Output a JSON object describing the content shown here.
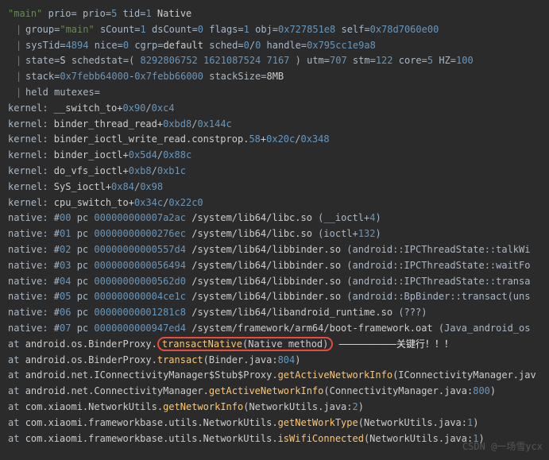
{
  "header": {
    "thread_name": "\"main\"",
    "prio_label": "prio=",
    "prio": "5",
    "tid_label": "tid=",
    "tid": "1",
    "type": "Native"
  },
  "group_line": {
    "group_label": "group=",
    "group": "\"main\"",
    "sCount_label": "sCount=",
    "sCount": "1",
    "dsCount_label": "dsCount=",
    "dsCount": "0",
    "flags_label": "flags=",
    "flags": "1",
    "obj_label": "obj=",
    "obj": "0x727851e8",
    "self_label": "self=",
    "self": "0x78d7060e00"
  },
  "systid_line": {
    "sysTid_label": "sysTid=",
    "sysTid": "4894",
    "nice_label": "nice=",
    "nice": "0",
    "cgrp_label": "cgrp=",
    "cgrp": "default",
    "sched_label": "sched=",
    "sched_a": "0",
    "slash": "/",
    "sched_b": "0",
    "handle_label": "handle=",
    "handle": "0x795cc1e9a8"
  },
  "state_line": {
    "state_label": "state=",
    "state": "S",
    "schedstat_label": "schedstat=( ",
    "ss1": "8292806752",
    "ss2": "1621087524",
    "ss3": "7167",
    "schedstat_close": " )",
    "utm_label": "utm=",
    "utm": "707",
    "stm_label": "stm=",
    "stm": "122",
    "core_label": "core=",
    "core": "5",
    "hz_label": "HZ=",
    "hz": "100"
  },
  "stack_line": {
    "stack_label": "stack=",
    "stack_a": "0x7febb64000",
    "dash": "-",
    "stack_b": "0x7febb66000",
    "stackSize_label": "stackSize=",
    "stackSize": "8MB"
  },
  "held_line": {
    "text": "held mutexes="
  },
  "kernel": [
    {
      "prefix": "kernel: ",
      "name": "__switch_to+",
      "a": "0x90",
      "sep": "/",
      "b": "0xc4"
    },
    {
      "prefix": "kernel: ",
      "name": "binder_thread_read+",
      "a": "0xbd8",
      "sep": "/",
      "b": "0x144c"
    },
    {
      "prefix": "kernel: ",
      "name": "binder_ioctl_write_read.constprop.",
      "mid": "58",
      "plus": "+",
      "a": "0x20c",
      "sep": "/",
      "b": "0x348"
    },
    {
      "prefix": "kernel: ",
      "name": "binder_ioctl+",
      "a": "0x5d4",
      "sep": "/",
      "b": "0x88c"
    },
    {
      "prefix": "kernel: ",
      "name": "do_vfs_ioctl+",
      "a": "0xb8",
      "sep": "/",
      "b": "0xb1c"
    },
    {
      "prefix": "kernel: ",
      "name": "SyS_ioctl+",
      "a": "0x84",
      "sep": "/",
      "b": "0x98"
    },
    {
      "prefix": "kernel: ",
      "name": "cpu_switch_to+",
      "a": "0x34c",
      "sep": "/",
      "b": "0x22c0"
    }
  ],
  "native": [
    {
      "prefix": "native: #",
      "num": "00",
      "pc_label": " pc ",
      "pc": "000000000007a2ac",
      "path": "/system/lib64/libc.so ",
      "sym": "(__ioctl+",
      "off": "4",
      "close": ")"
    },
    {
      "prefix": "native: #",
      "num": "01",
      "pc_label": " pc ",
      "pc": "00000000000276ec",
      "path": "/system/lib64/libc.so ",
      "sym": "(ioctl+",
      "off": "132",
      "close": ")"
    },
    {
      "prefix": "native: #",
      "num": "02",
      "pc_label": " pc ",
      "pc": "00000000000557d4",
      "path": "/system/lib64/libbinder.so ",
      "sym": "(android::IPCThreadState::talkWi"
    },
    {
      "prefix": "native: #",
      "num": "03",
      "pc_label": " pc ",
      "pc": "0000000000056494",
      "path": "/system/lib64/libbinder.so ",
      "sym": "(android::IPCThreadState::waitFo"
    },
    {
      "prefix": "native: #",
      "num": "04",
      "pc_label": " pc ",
      "pc": "00000000000562d0",
      "path": "/system/lib64/libbinder.so ",
      "sym": "(android::IPCThreadState::transa"
    },
    {
      "prefix": "native: #",
      "num": "05",
      "pc_label": " pc ",
      "pc": "000000000004ce1c",
      "path": "/system/lib64/libbinder.so ",
      "sym": "(android::BpBinder::transact(uns"
    },
    {
      "prefix": "native: #",
      "num": "06",
      "pc_label": " pc ",
      "pc": "00000000001281c8",
      "path": "/system/lib64/libandroid_runtime.so ",
      "sym": "(???)"
    },
    {
      "prefix": "native: #",
      "num": "07",
      "pc_label": " pc ",
      "pc": "0000000000947ed4",
      "path": "/system/framework/arm64/boot-framework.oat ",
      "sym": "(Java_android_os"
    }
  ],
  "java": [
    {
      "prefix": "at ",
      "cls": "android.os.BinderProxy.",
      "method": "transactNative",
      "args": "(Native method)",
      "highlight": true,
      "annot": " ——————————关键行！！！"
    },
    {
      "prefix": "at ",
      "cls": "android.os.BinderProxy.",
      "method": "transact",
      "args": "(Binder.java:",
      "line": "804",
      "close": ")"
    },
    {
      "prefix": "at ",
      "cls": "android.net.IConnectivityManager$Stub$Proxy.",
      "method": "getActiveNetworkInfo",
      "args": "(IConnectivityManager.jav"
    },
    {
      "prefix": "at ",
      "cls": "android.net.ConnectivityManager.",
      "method": "getActiveNetworkInfo",
      "args": "(ConnectivityManager.java:",
      "line": "800",
      "close": ")"
    },
    {
      "prefix": "at ",
      "cls": "com.xiaomi.NetworkUtils.",
      "method": "getNetworkInfo",
      "args": "(NetworkUtils.java:",
      "line": "2",
      "close": ")"
    },
    {
      "prefix": "at ",
      "cls": "com.xiaomi.frameworkbase.utils.NetworkUtils.",
      "method": "getNetWorkType",
      "args": "(NetworkUtils.java:",
      "line": "1",
      "close": ")"
    },
    {
      "prefix": "at ",
      "cls": "com.xiaomi.frameworkbase.utils.NetworkUtils.",
      "method": "isWifiConnected",
      "args": "(NetworkUtils.java:",
      "line": "1",
      "close": ")"
    }
  ],
  "watermark": "CSDN @一场雪ycx"
}
